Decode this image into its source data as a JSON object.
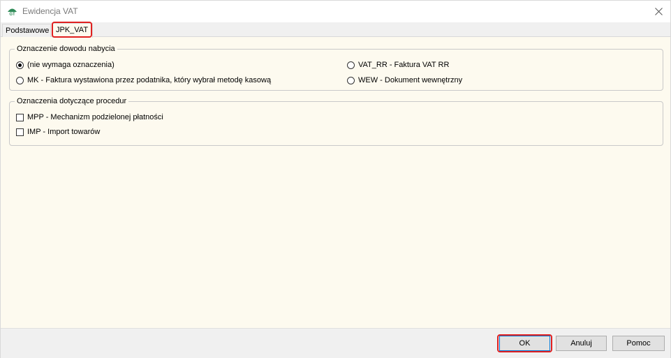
{
  "window": {
    "title": "Ewidencja VAT",
    "icon": "app-logo-icon",
    "close_icon": "close-icon"
  },
  "tabs": [
    {
      "label": "Podstawowe",
      "active": false
    },
    {
      "label": "JPK_VAT",
      "active": true
    }
  ],
  "group_acquisition": {
    "legend": "Oznaczenie dowodu nabycia",
    "options": [
      {
        "label": "(nie wymaga oznaczenia)",
        "checked": true
      },
      {
        "label": "MK - Faktura wystawiona przez podatnika, który wybrał metodę kasową",
        "checked": false
      },
      {
        "label": "VAT_RR - Faktura VAT RR",
        "checked": false
      },
      {
        "label": "WEW - Dokument wewnętrzny",
        "checked": false
      }
    ]
  },
  "group_procedures": {
    "legend": "Oznaczenia dotyczące procedur",
    "options": [
      {
        "label": "MPP - Mechanizm podzielonej płatności",
        "checked": false
      },
      {
        "label": "IMP - Import towarów",
        "checked": false
      }
    ]
  },
  "buttons": {
    "ok": "OK",
    "cancel": "Anuluj",
    "help": "Pomoc"
  },
  "colors": {
    "highlight": "#e02020",
    "panel": "#fdfaef"
  }
}
